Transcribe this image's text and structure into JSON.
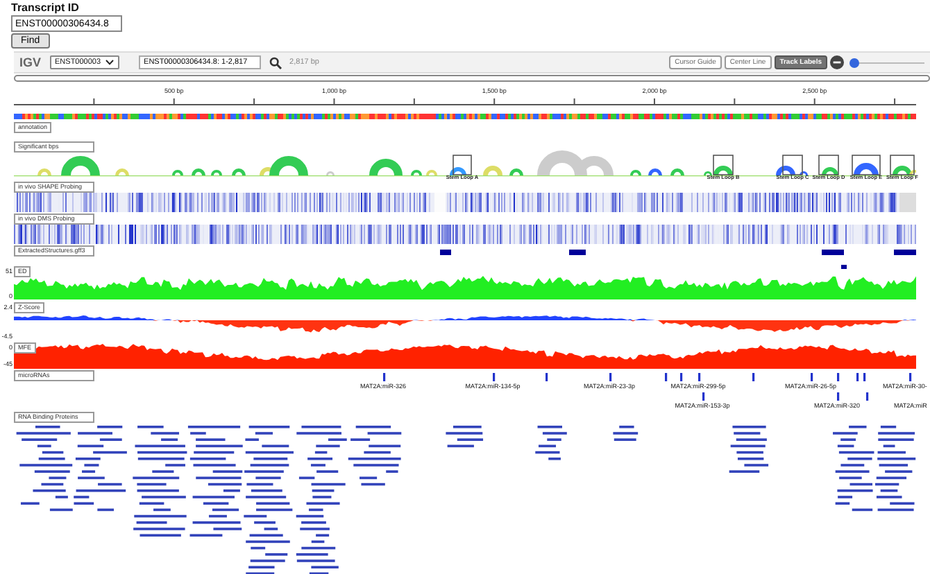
{
  "search_form": {
    "label": "Transcript ID",
    "value": "ENST00000306434.8",
    "button": "Find"
  },
  "igv_toolbar": {
    "logo": "IGV",
    "genome_select": "ENST000003",
    "locus": "ENST00000306434.8: 1-2,817",
    "span": "2,817 bp",
    "buttons": [
      {
        "label": "Cursor Guide",
        "selected": false
      },
      {
        "label": "Center Line",
        "selected": false
      },
      {
        "label": "Track Labels",
        "selected": true
      }
    ],
    "zoom": {
      "level": 0.02
    }
  },
  "ruler": {
    "ticks": [
      "500 bp",
      "1,000 bp",
      "1,500 bp",
      "2,000 bp",
      "2,500 bp"
    ]
  },
  "tracks": [
    {
      "kind": "sequence"
    },
    {
      "kind": "label",
      "label": "annotation"
    },
    {
      "kind": "arcs",
      "label": "Significant bps",
      "stem_loops": [
        "Stem Loop A",
        "Stem Loop B",
        "Stem Loop C",
        "Stem Loop D",
        "Stem Loop E",
        "Stem Loop F"
      ]
    },
    {
      "kind": "heatmap",
      "label": "in vivo SHAPE Probing"
    },
    {
      "kind": "heatmap",
      "label": "in vivo DMS Probing"
    },
    {
      "kind": "features",
      "label": "ExtractedStructures.gff3"
    },
    {
      "kind": "ed",
      "label": "ED",
      "axis_max": "51",
      "axis_min": "0"
    },
    {
      "kind": "zscore",
      "label": "Z-Score",
      "axis_max": "2.4",
      "axis_min": "-4.5"
    },
    {
      "kind": "mfe",
      "label": "MFE",
      "axis_max": "0",
      "axis_min": "-45"
    },
    {
      "kind": "mirna",
      "label": "microRNAs",
      "row_1": [
        "MAT2A:miR-326",
        "MAT2A:miR-134-5p",
        "MAT2A:miR-23-3p",
        "MAT2A:miR-299-5p",
        "MAT2A:miR-26-5p",
        "MAT2A:miR-30-"
      ],
      "row_2": [
        "MAT2A:miR-153-3p",
        "MAT2A:miR-320",
        "MAT2A:miR"
      ]
    },
    {
      "kind": "rbp",
      "label": "RNA Binding Proteins"
    }
  ]
}
